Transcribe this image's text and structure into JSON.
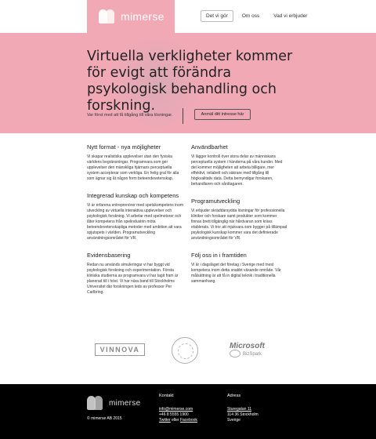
{
  "brand": {
    "name": "mimerse"
  },
  "nav": [
    {
      "label": "Det vi gör",
      "active": true
    },
    {
      "label": "Om oss",
      "active": false
    },
    {
      "label": "Vad vi erbjuder",
      "active": false
    }
  ],
  "hero": {
    "headline": "Virtuella verkligheter kommer för evigt att förändra psykologisk behandling och forskning.",
    "subtext": "Var först med att få tillgång till våra lösningar.",
    "cta_label": "Anmäl ditt intresse här"
  },
  "left_column": [
    {
      "title": "Nytt format - nya möjligheter",
      "body": "Vi skapar realistiska upplevelser utan den fysiska världens begränsningar. Programvara som ger upplevelser den mänskliga hjärnans perceptuella system accepterar som verkliga. En helig gral för alla som ägnar sig åt någon form beteendevetenskap."
    },
    {
      "title": "Integrerad kunskap och kompetens",
      "body": "Vi är erfarena entreprenörer med spetskompetens inom utveckling av virtuella interaktiva upplevelser och psykologisk forskning. Vi arbetar med spelmotorer och låter kompetens från spelindustrin möta beteendevetenskapliga metoder med ambition att vara spjutspets i världen. Programutveckling användningsområdet för VR."
    },
    {
      "title": "Evidensbasering",
      "body": "Redan nu används simuleringar vi har byggt vid psykologisk forskning och experimentation. Första kliniska studierna av programvara vi har tagit fram är planerad till i höst. Vi har nära band till Stockholms Universitet där forskningen leds av professor Per Carlbring."
    }
  ],
  "right_column": [
    {
      "title": "Användbarhet",
      "body": "Vi lägger kontroll över stora delar av människans perceptuella system i händerna på våra kunder. Med det kommer möjligheten att arbeta billigare, mer effektivt, reliabelt och säkrare med tillgång till högkvalitativ data. Detta bemyndigar forskaren, behandlaren och vårdtagaren."
    },
    {
      "title": "Programutveckling",
      "body": "Vi erbjuder skräddarsydda lösningar för professionella kliniker och forskare samt produkter som kommer finnas brett tillgänglig när hårdvaran som krävs etablerats. Vi tror att mjukvara som bygger på tillämpad psykologisk kunskap kommer vara det definierade användningsområdet för VR."
    },
    {
      "title": "Följ oss in i framtiden",
      "body": "Vi är i dagsläget det företag i Sverige med mest kompetens inom detta snabbt växande område. Vår målsättning är att få in digital teknik i traditionella sammanhang."
    }
  ],
  "partners": {
    "vinnova": "VINNOVA",
    "microsoft": "Microsoft",
    "bizspark": "BizSpark"
  },
  "footer": {
    "brand": "mimerse",
    "copyright": "© mimerse AB 2015",
    "contact_title": "Kontakt",
    "email": "info@mimerse.com",
    "phone": "+46 8 5555 1900",
    "twitter": "Twitter",
    "or": " eller ",
    "facebook": "Facebook",
    "address_title": "Adress",
    "street": "Sturegatan 11",
    "postal": "114 36 Stockholm",
    "country": "Sverige"
  },
  "colors": {
    "accent": "#f2a9b6",
    "footer": "#000000"
  }
}
